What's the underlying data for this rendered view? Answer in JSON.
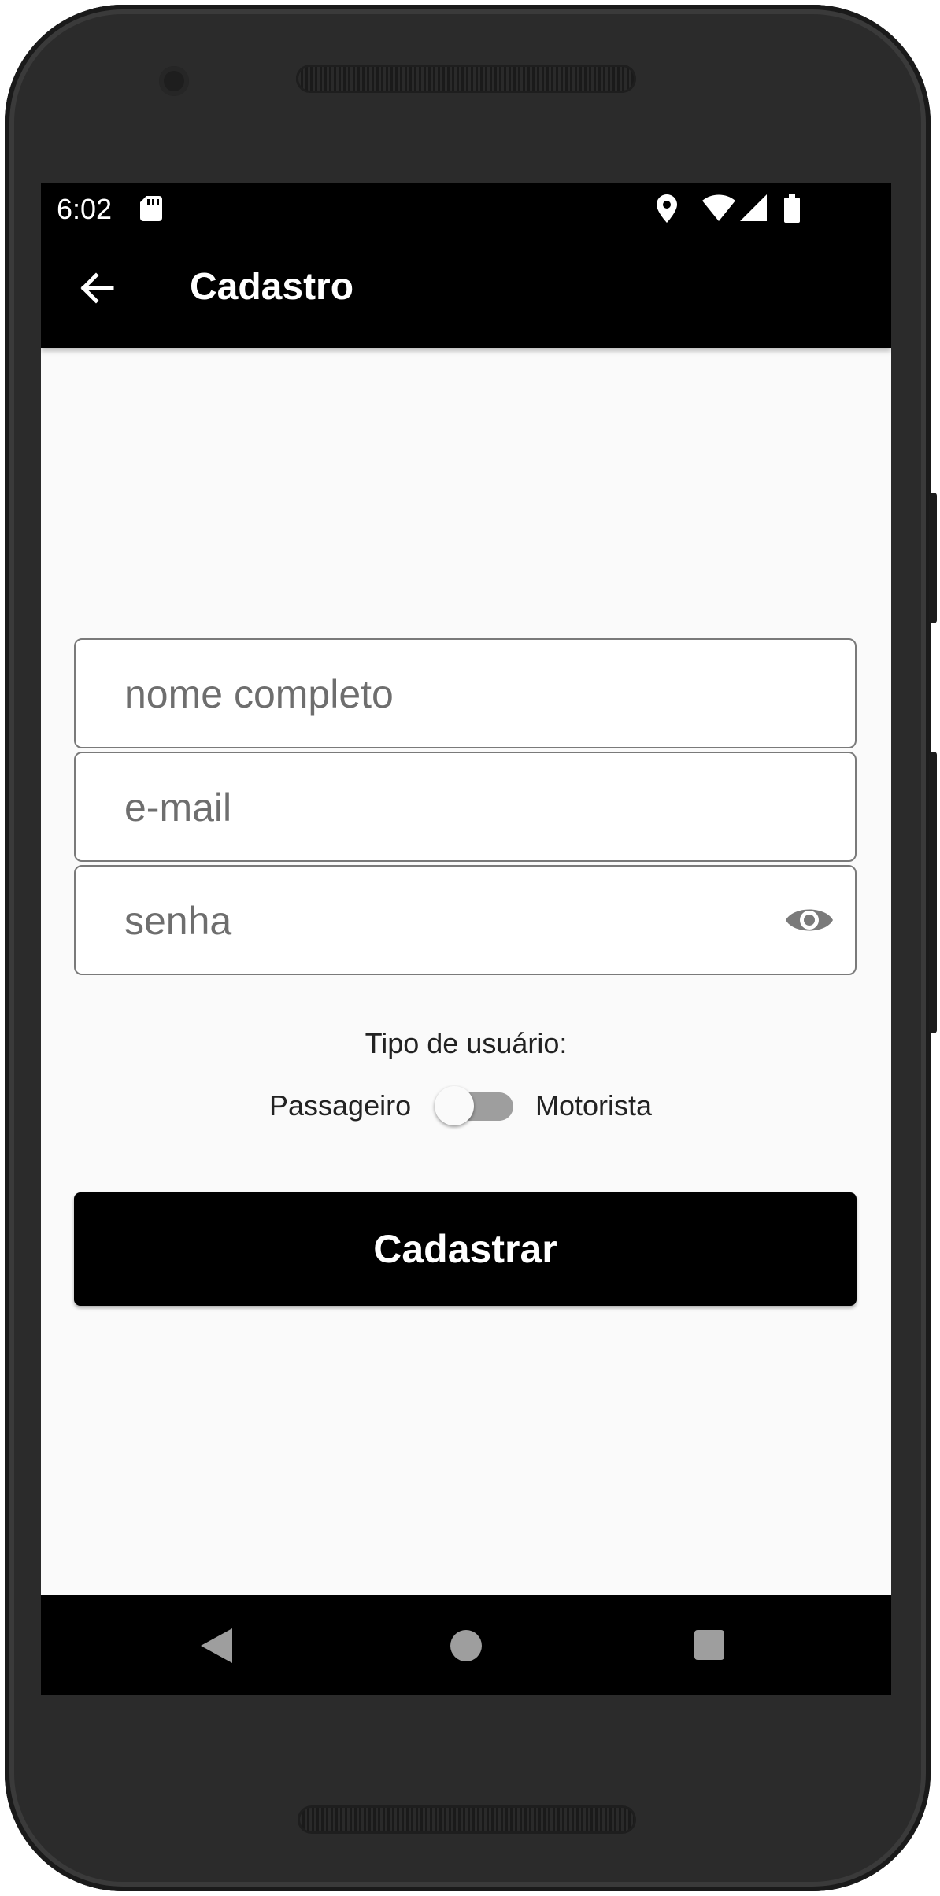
{
  "status_bar": {
    "time": "6:02"
  },
  "app_bar": {
    "title": "Cadastro"
  },
  "form": {
    "name_placeholder": "nome completo",
    "email_placeholder": "e-mail",
    "password_placeholder": "senha",
    "user_type_label": "Tipo de usuário:",
    "option_left": "Passageiro",
    "option_right": "Motorista",
    "toggle_on": false,
    "submit_label": "Cadastrar"
  },
  "icons": {
    "back": "arrow-back-icon",
    "visibility": "eye-icon",
    "sd_card": "sd-card-icon",
    "location": "location-icon",
    "wifi": "wifi-icon",
    "signal": "signal-icon",
    "battery": "battery-icon"
  },
  "colors": {
    "app_bar": "#000000",
    "button": "#000000",
    "background": "#fafafa"
  }
}
